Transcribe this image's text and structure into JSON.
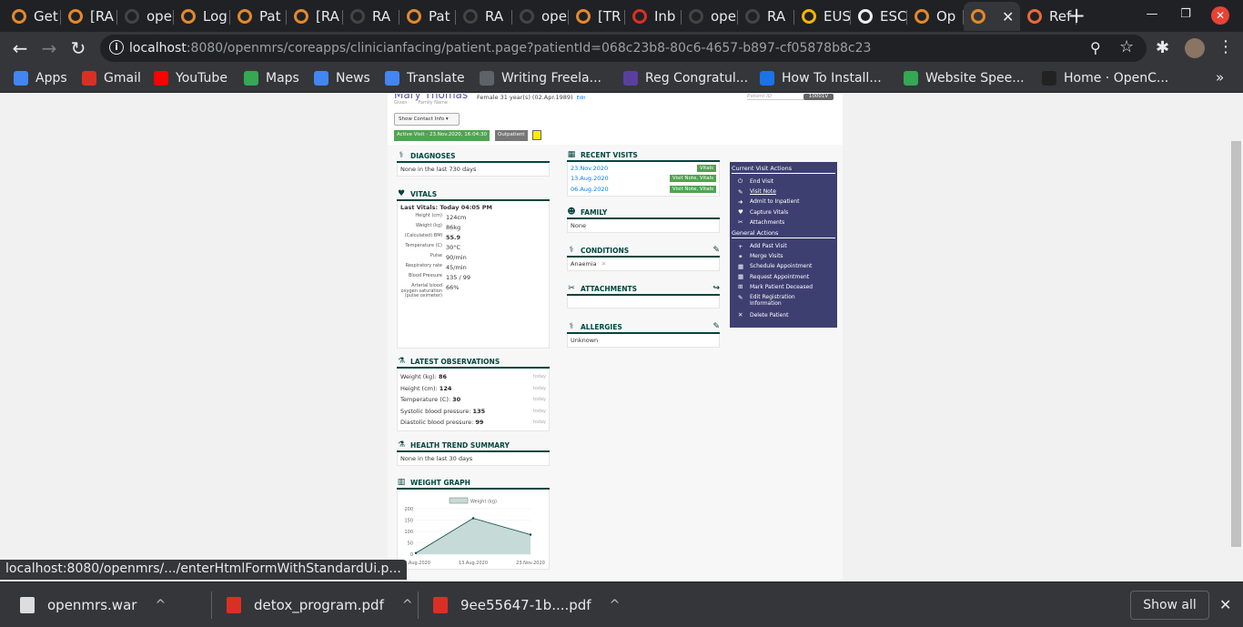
{
  "browser": {
    "tabs": [
      {
        "label": "Get",
        "color": "#e2892b"
      },
      {
        "label": "[RA",
        "color": "#e2892b"
      },
      {
        "label": "ope",
        "color": "#444"
      },
      {
        "label": "Log",
        "color": "#e2892b"
      },
      {
        "label": "Pat",
        "color": "#e2892b"
      },
      {
        "label": "[RA",
        "color": "#e2892b"
      },
      {
        "label": "RA",
        "color": "#444"
      },
      {
        "label": "Pat",
        "color": "#e2892b"
      },
      {
        "label": "RA",
        "color": "#444"
      },
      {
        "label": "ope",
        "color": "#444"
      },
      {
        "label": "[TR",
        "color": "#e2892b"
      },
      {
        "label": "Inb",
        "color": "#d93025"
      },
      {
        "label": "ope",
        "color": "#444"
      },
      {
        "label": "RA",
        "color": "#444"
      },
      {
        "label": "EUS",
        "color": "#f4b400"
      },
      {
        "label": "ESC",
        "color": "#eee"
      },
      {
        "label": "Op",
        "color": "#e2892b"
      },
      {
        "label": "",
        "color": "#e2892b",
        "active": true
      },
      {
        "label": "Ref",
        "color": "#ea6a3a"
      }
    ],
    "active_tab_close": "✕",
    "new_tab": "+",
    "window_controls": {
      "minimize": "—",
      "restore": "❐",
      "close": "✕"
    },
    "nav": {
      "back": "←",
      "forward": "→",
      "reload": "↻"
    },
    "url_host": "localhost",
    "url_rest": ":8080/openmrs/coreapps/clinicianfacing/patient.page?patientId=068c23b8-80c6-4657-b897-cf05878b8c23",
    "bookmarks": [
      {
        "label": "Apps",
        "color": "#4285f4"
      },
      {
        "label": "Gmail",
        "color": "#d93025"
      },
      {
        "label": "YouTube",
        "color": "#ff0000"
      },
      {
        "label": "Maps",
        "color": "#34a853"
      },
      {
        "label": "News",
        "color": "#4285f4"
      },
      {
        "label": "Translate",
        "color": "#4285f4"
      },
      {
        "label": "Writing Freela...",
        "color": "#5f6368"
      },
      {
        "label": "Reg Congratul...",
        "color": "#5b3fa0"
      },
      {
        "label": "How To Install...",
        "color": "#1a73e8"
      },
      {
        "label": "Website Spee...",
        "color": "#34a853"
      },
      {
        "label": "Home · OpenC...",
        "color": "#222"
      }
    ],
    "bookmarks_more": "»",
    "status_url": "localhost:8080/openmrs/.../enterHtmlFormWithStandardUi.p...",
    "downloads": [
      {
        "name": "openmrs.war",
        "color": "#ddd"
      },
      {
        "name": "detox_program.pdf",
        "color": "#d93025"
      },
      {
        "name": "9ee55647-1b....pdf",
        "color": "#d93025"
      }
    ],
    "show_all": "Show all",
    "shelf_close": "✕"
  },
  "patient": {
    "name": "Mary Thomas",
    "given_label": "Given",
    "family_label": "Family Name",
    "info": "Female  31 year(s) (02.Apr.1989)",
    "edit": "Edit",
    "id_label": "Patient ID",
    "id_value": "10001V",
    "contact_btn": "Show Contact Info ▾",
    "active_visit": "Active Visit - 23.Nov.2020, 16:04:30",
    "visit_type": "Outpatient"
  },
  "diagnoses": {
    "title": "DIAGNOSES",
    "body": "None in the last 730 days"
  },
  "vitals": {
    "title": "VITALS",
    "last": "Last Vitals: Today 04:05 PM",
    "rows": [
      {
        "label": "Height (cm)",
        "value": "124cm"
      },
      {
        "label": "Weight (kg)",
        "value": "86kg"
      },
      {
        "label": "(Calculated) BMI",
        "value": "55.9"
      },
      {
        "label": "Temperature (C)",
        "value": "30°C"
      },
      {
        "label": "Pulse",
        "value": "90/min"
      },
      {
        "label": "Respiratory rate",
        "value": "45/min"
      },
      {
        "label": "Blood Pressure",
        "value": "135 / 99"
      },
      {
        "label": "Arterial blood oxygen saturation (pulse oximeter)",
        "value": "66%"
      }
    ]
  },
  "observations": {
    "title": "LATEST OBSERVATIONS",
    "rows": [
      {
        "label": "Weight (kg): ",
        "value": "86",
        "date": "today"
      },
      {
        "label": "Height (cm): ",
        "value": "124",
        "date": "today"
      },
      {
        "label": "Temperature (C): ",
        "value": "30",
        "date": "today"
      },
      {
        "label": "Systolic blood pressure: ",
        "value": "135",
        "date": "today"
      },
      {
        "label": "Diastolic blood pressure: ",
        "value": "99",
        "date": "today"
      }
    ]
  },
  "health_trend": {
    "title": "HEALTH TREND SUMMARY",
    "body": "None in the last 30 days"
  },
  "weight_graph": {
    "title": "WEIGHT GRAPH"
  },
  "recent_visits": {
    "title": "RECENT VISITS",
    "rows": [
      {
        "date": "23.Nov.2020",
        "tag": "Vitals"
      },
      {
        "date": "13.Aug.2020",
        "tag": "Visit Note, Vitals"
      },
      {
        "date": "06.Aug.2020",
        "tag": "Visit Note, Vitals"
      }
    ]
  },
  "family": {
    "title": "FAMILY",
    "body": "None"
  },
  "conditions": {
    "title": "CONDITIONS",
    "item": "Anaemia",
    "remove": "✕"
  },
  "attachments": {
    "title": "ATTACHMENTS"
  },
  "allergies": {
    "title": "ALLERGIES",
    "body": "Unknown"
  },
  "actions": {
    "current_title": "Current Visit Actions",
    "current": [
      {
        "label": "End Visit",
        "icon": "⏻"
      },
      {
        "label": "Visit Note",
        "icon": "✎",
        "underline": true
      },
      {
        "label": "Admit to Inpatient",
        "icon": "➜"
      },
      {
        "label": "Capture Vitals",
        "icon": "♥"
      },
      {
        "label": "Attachments",
        "icon": "✂"
      }
    ],
    "general_title": "General Actions",
    "general": [
      {
        "label": "Add Past Visit",
        "icon": "+"
      },
      {
        "label": "Merge Visits",
        "icon": "⚭"
      },
      {
        "label": "Schedule Appointment",
        "icon": "▦"
      },
      {
        "label": "Request Appointment",
        "icon": "▦"
      },
      {
        "label": "Mark Patient Deceased",
        "icon": "⊞"
      },
      {
        "label": "Edit Registration Information",
        "icon": "✎"
      },
      {
        "label": "Delete Patient",
        "icon": "✕"
      }
    ]
  },
  "chart_data": {
    "type": "area",
    "title": "",
    "legend": "Weight (kg)",
    "categories": [
      "06.Aug.2020",
      "13.Aug.2020",
      "23.Nov.2020"
    ],
    "series": [
      {
        "name": "Weight (kg)",
        "values": [
          5,
          158,
          86
        ]
      }
    ],
    "yticks": [
      0,
      50,
      100,
      150,
      200
    ],
    "ylim": [
      0,
      200
    ],
    "colors": {
      "fill": "#c6dad7",
      "stroke": "#00463f"
    }
  }
}
